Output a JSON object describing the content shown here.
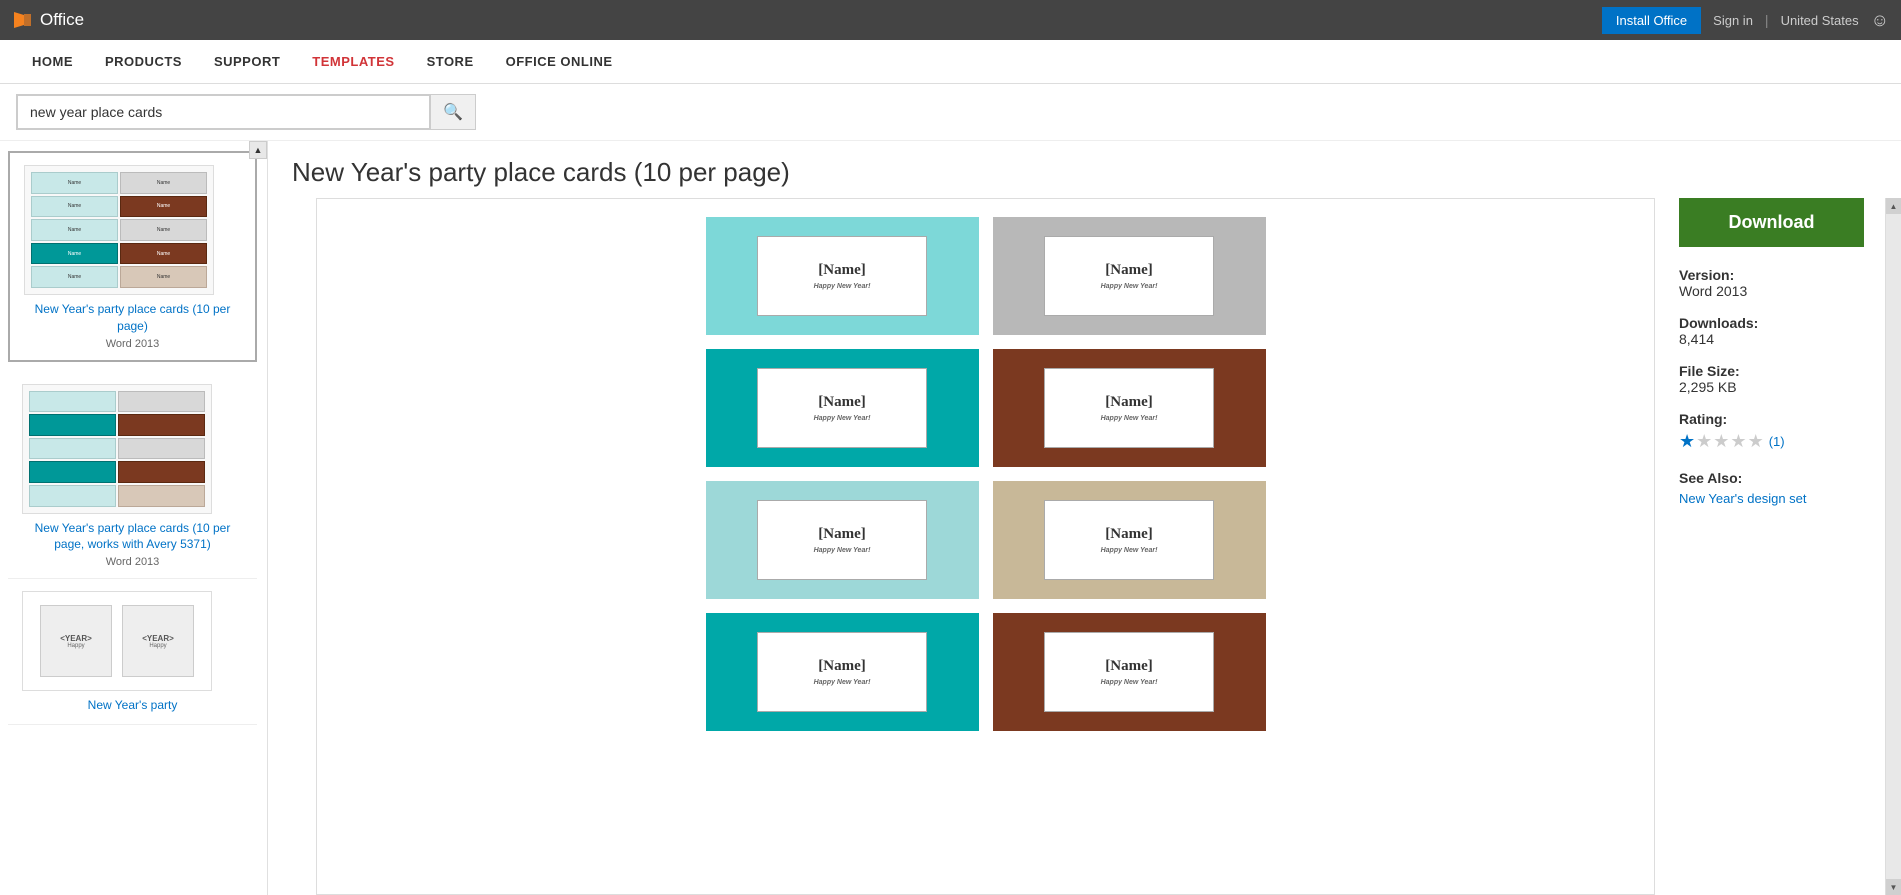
{
  "topbar": {
    "office_label": "Office",
    "install_btn": "Install Office",
    "signin_label": "Sign in",
    "region_label": "United States",
    "smiley": "☺"
  },
  "navbar": {
    "items": [
      {
        "label": "HOME",
        "active": false
      },
      {
        "label": "PRODUCTS",
        "active": false
      },
      {
        "label": "SUPPORT",
        "active": false
      },
      {
        "label": "TEMPLATES",
        "active": true
      },
      {
        "label": "STORE",
        "active": false
      },
      {
        "label": "OFFICE ONLINE",
        "active": false
      }
    ]
  },
  "search": {
    "value": "new year place cards",
    "placeholder": "Search templates"
  },
  "page": {
    "title": "New Year's party place cards (10 per page)"
  },
  "sidebar": {
    "cards": [
      {
        "title": "New Year's party place cards (10 per page)",
        "version": "Word 2013"
      },
      {
        "title": "New Year's party place cards (10 per page, works with Avery 5371)",
        "version": "Word 2013"
      },
      {
        "title": "New Year's party",
        "version": ""
      }
    ]
  },
  "template": {
    "cards": [
      {
        "style": "teal",
        "name": "[Name]",
        "subtitle": "Happy New Year!"
      },
      {
        "style": "gray",
        "name": "[Name]",
        "subtitle": "Happy New Year!"
      },
      {
        "style": "dark-teal",
        "name": "[Name]",
        "subtitle": "Happy New Year!"
      },
      {
        "style": "brown",
        "name": "[Name]",
        "subtitle": "Happy New Year!"
      },
      {
        "style": "light-teal",
        "name": "[Name]",
        "subtitle": "Happy New Year!"
      },
      {
        "style": "taupe",
        "name": "[Name]",
        "subtitle": "Happy New Year!"
      },
      {
        "style": "dark-teal",
        "name": "[Name]",
        "subtitle": "Happy New Year!"
      },
      {
        "style": "brown",
        "name": "[Name]",
        "subtitle": "Happy New Year!"
      }
    ]
  },
  "info_panel": {
    "download_btn": "Download",
    "version_label": "Version:",
    "version_value": "Word 2013",
    "downloads_label": "Downloads:",
    "downloads_value": "8,414",
    "filesize_label": "File Size:",
    "filesize_value": "2,295 KB",
    "rating_label": "Rating:",
    "rating_count": "(1)",
    "see_also_label": "See Also:",
    "see_also_link": "New Year's design set"
  }
}
